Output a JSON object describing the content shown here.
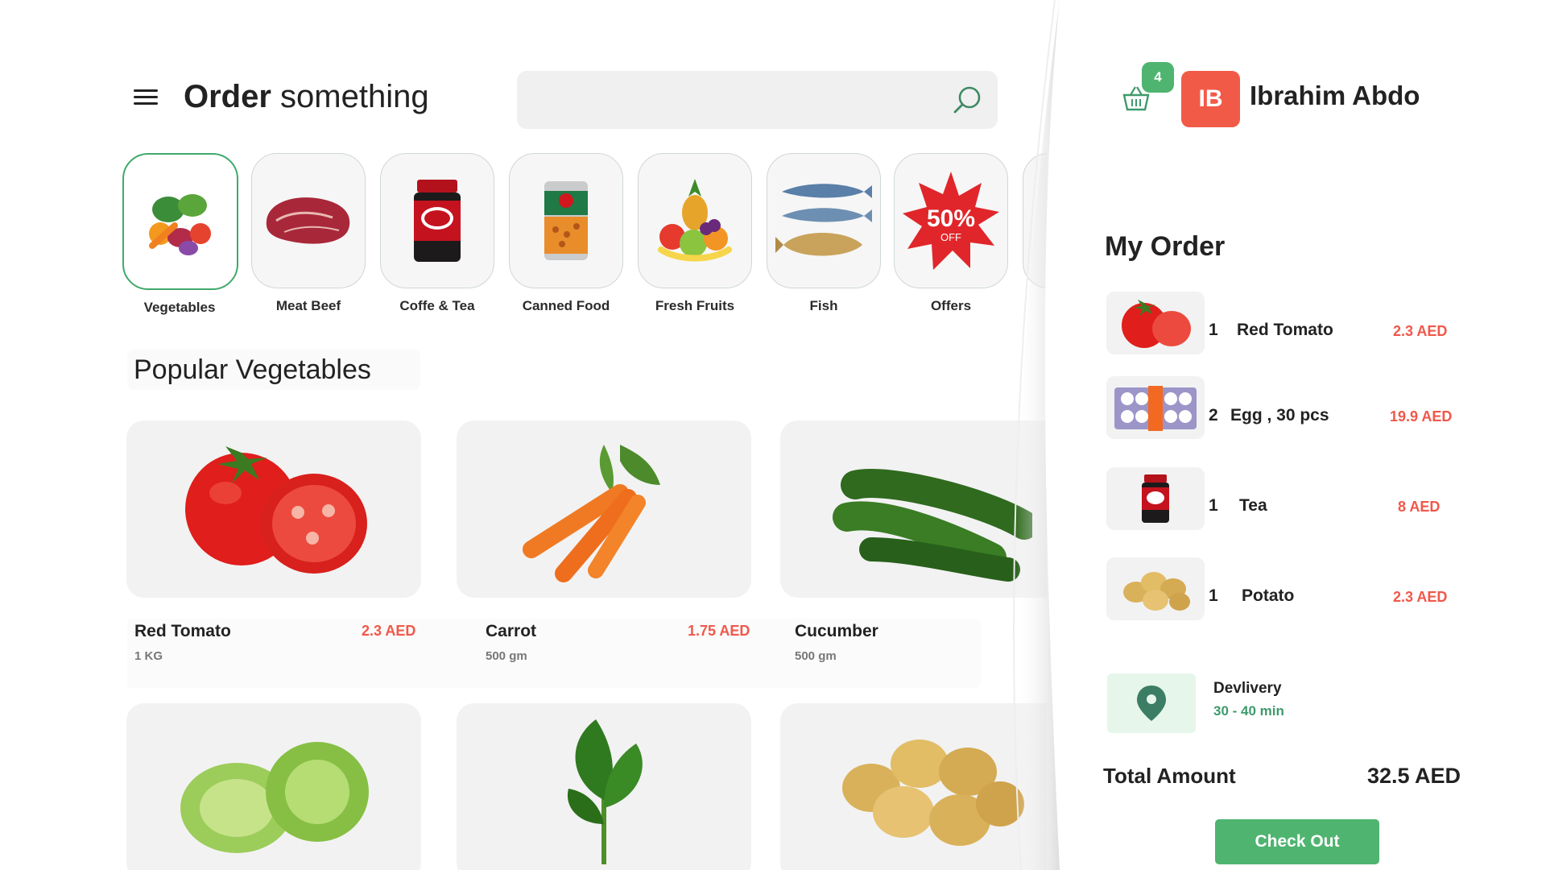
{
  "header": {
    "title_bold": "Order",
    "title_rest": " something",
    "search_placeholder": ""
  },
  "categories": [
    {
      "label": "Vegetables",
      "icon": "vegetables-icon",
      "active": true
    },
    {
      "label": "Meat Beef",
      "icon": "beef-icon"
    },
    {
      "label": "Coffe & Tea",
      "icon": "tea-jar-icon"
    },
    {
      "label": "Canned Food",
      "icon": "can-icon"
    },
    {
      "label": "Fresh Fruits",
      "icon": "fruits-icon"
    },
    {
      "label": "Fish",
      "icon": "fish-icon"
    },
    {
      "label": "Offers",
      "icon": "offer-badge-icon",
      "badge_main": "50%",
      "badge_sub": "OFF"
    }
  ],
  "section": {
    "title": "Popular Vegetables"
  },
  "products": [
    {
      "name": "Red Tomato",
      "price": "2.3 AED",
      "qty": "1 KG",
      "icon": "tomato-icon"
    },
    {
      "name": "Carrot",
      "price": "1.75 AED",
      "qty": "500 gm",
      "icon": "carrot-icon"
    },
    {
      "name": "Cucumber",
      "price": "",
      "qty": "500 gm",
      "icon": "cucumber-icon"
    },
    {
      "name": "",
      "price": "",
      "qty": "",
      "icon": "lettuce-icon"
    },
    {
      "name": "",
      "price": "",
      "qty": "",
      "icon": "spinach-icon"
    },
    {
      "name": "",
      "price": "",
      "qty": "",
      "icon": "potato-icon"
    }
  ],
  "cart": {
    "count": "4"
  },
  "user": {
    "initials": "IB",
    "name": "Ibrahim Abdo"
  },
  "order": {
    "title": "My Order",
    "items": [
      {
        "qty": "1",
        "name": "Red Tomato",
        "price": "2.3 AED",
        "icon": "tomato-icon"
      },
      {
        "qty": "2",
        "name": "Egg , 30 pcs",
        "price": "19.9 AED",
        "icon": "eggs-icon"
      },
      {
        "qty": "1",
        "name": "Tea",
        "price": "8 AED",
        "icon": "tea-jar-icon"
      },
      {
        "qty": "1",
        "name": "Potato",
        "price": "2.3 AED",
        "icon": "potato-icon"
      }
    ],
    "delivery_label": "Devlivery",
    "delivery_time": "30 - 40 min",
    "total_label": "Total Amount",
    "total_value": "32.5 AED",
    "checkout_label": "Check Out"
  },
  "colors": {
    "accent_green": "#4fb470",
    "price_red": "#f0584a",
    "avatar_red": "#f25a48"
  }
}
